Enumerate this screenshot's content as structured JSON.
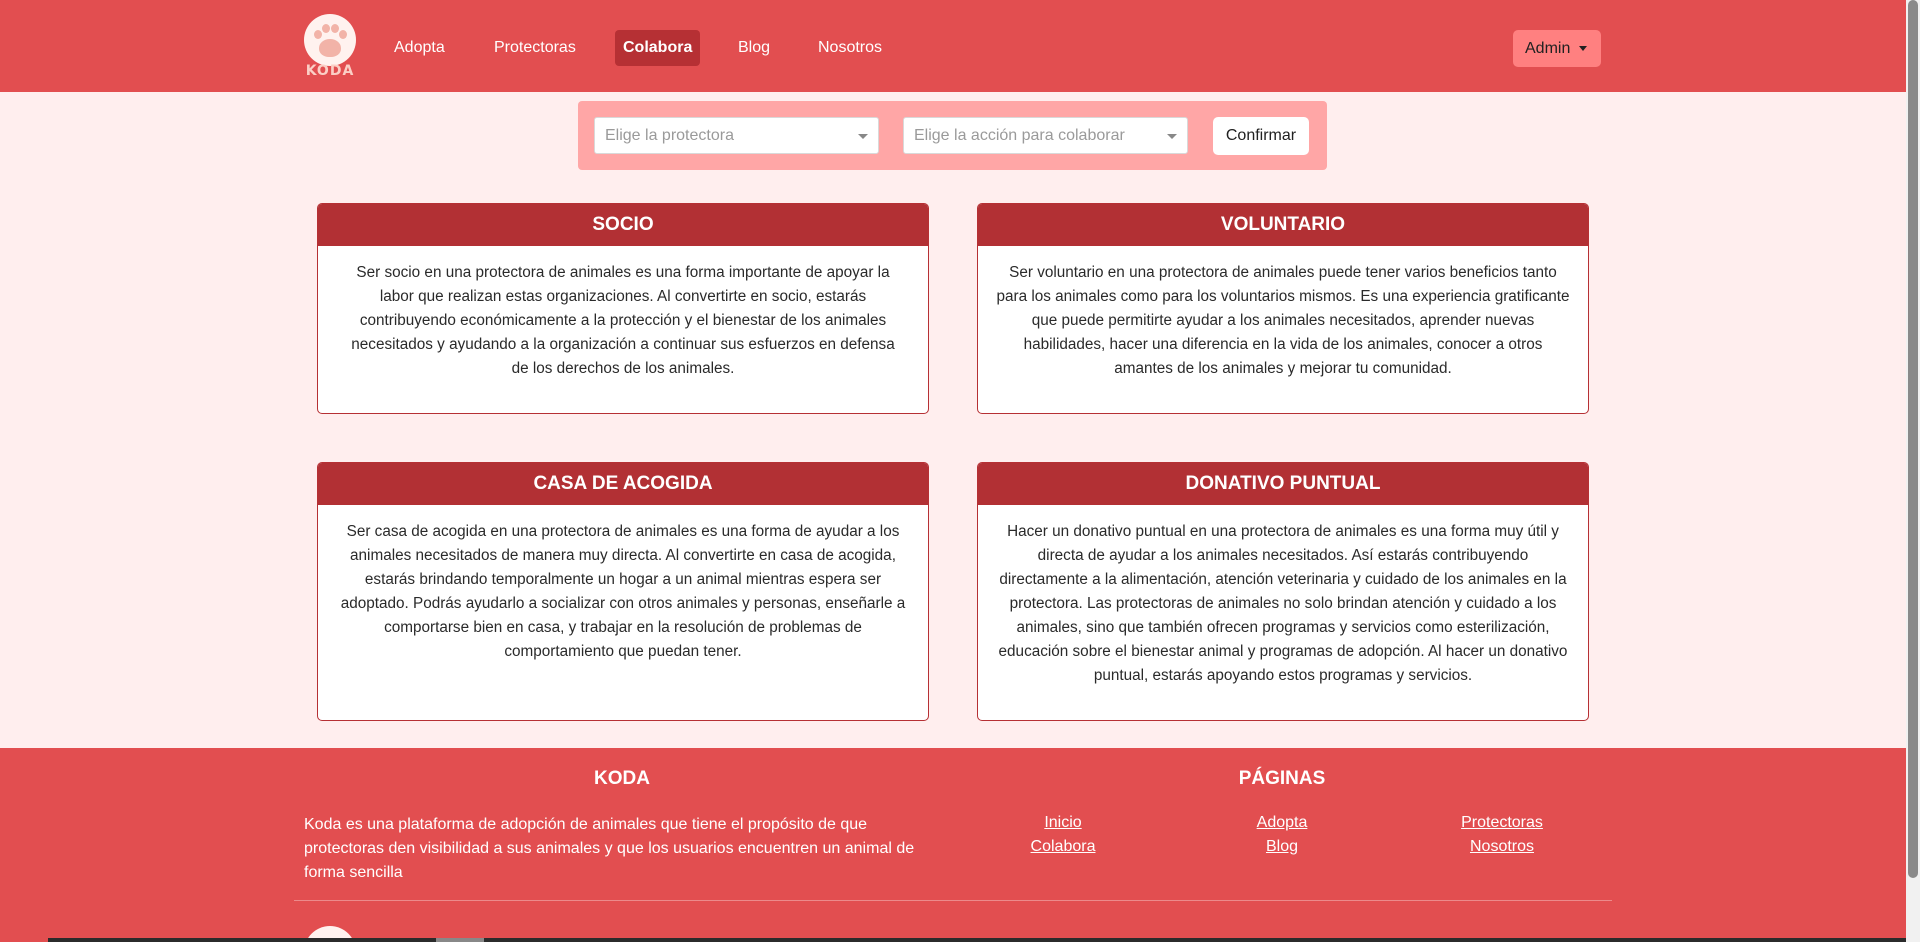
{
  "brand": {
    "name": "KODA"
  },
  "nav": {
    "items": [
      {
        "label": "Adopta"
      },
      {
        "label": "Protectoras"
      },
      {
        "label": "Colabora"
      },
      {
        "label": "Blog"
      },
      {
        "label": "Nosotros"
      }
    ],
    "active": "Colabora",
    "user_menu": "Admin"
  },
  "filters": {
    "protectora_placeholder": "Elige la protectora",
    "accion_placeholder": "Elige la acción para colaborar",
    "confirm_label": "Confirmar"
  },
  "cards": [
    {
      "title": "SOCIO",
      "text": "Ser socio en una protectora de animales es una forma importante de apoyar la labor que realizan estas organizaciones. Al convertirte en socio, estarás contribuyendo económicamente a la protección y el bienestar de los animales necesitados y ayudando a la organización a continuar sus esfuerzos en defensa de los derechos de los animales."
    },
    {
      "title": "VOLUNTARIO",
      "text": "Ser voluntario en una protectora de animales puede tener varios beneficios tanto para los animales como para los voluntarios mismos. Es una experiencia gratificante que puede permitirte ayudar a los animales necesitados, aprender nuevas habilidades, hacer una diferencia en la vida de los animales, conocer a otros amantes de los animales y mejorar tu comunidad."
    },
    {
      "title": "CASA DE ACOGIDA",
      "text": "Ser casa de acogida en una protectora de animales es una forma de ayudar a los animales necesitados de manera muy directa. Al convertirte en casa de acogida, estarás brindando temporalmente un hogar a un animal mientras espera ser adoptado. Podrás ayudarlo a socializar con otros animales y personas, enseñarle a comportarse bien en casa, y trabajar en la resolución de problemas de comportamiento que puedan tener."
    },
    {
      "title": "DONATIVO PUNTUAL",
      "text": "Hacer un donativo puntual en una protectora de animales es una forma muy útil y directa de ayudar a los animales necesitados. Así estarás contribuyendo directamente a la alimentación, atención veterinaria y cuidado de los animales en la protectora. Las protectoras de animales no solo brindan atención y cuidado a los animales, sino que también ofrecen programas y servicios como esterilización, educación sobre el bienestar animal y programas de adopción. Al hacer un donativo puntual, estarás apoyando estos programas y servicios."
    }
  ],
  "footer": {
    "about_title": "KODA",
    "about_text": "Koda es una plataforma de adopción de animales que tiene el propósito de que protectoras den visibilidad a sus animales y que los usuarios encuentren un animal de forma sencilla",
    "pages_title": "PÁGINAS",
    "links": [
      "Inicio",
      "Colabora",
      "Adopta",
      "Blog",
      "Protectoras",
      "Nosotros"
    ]
  },
  "colors": {
    "primary": "#e24e50",
    "card_header": "#b23034",
    "background": "#ffeeee",
    "filter_bar": "#ffa6a6",
    "admin_button": "#ff8080"
  },
  "icons": [
    "paw-logo-icon",
    "dropdown-caret-icon",
    "chevron-down-icon"
  ]
}
